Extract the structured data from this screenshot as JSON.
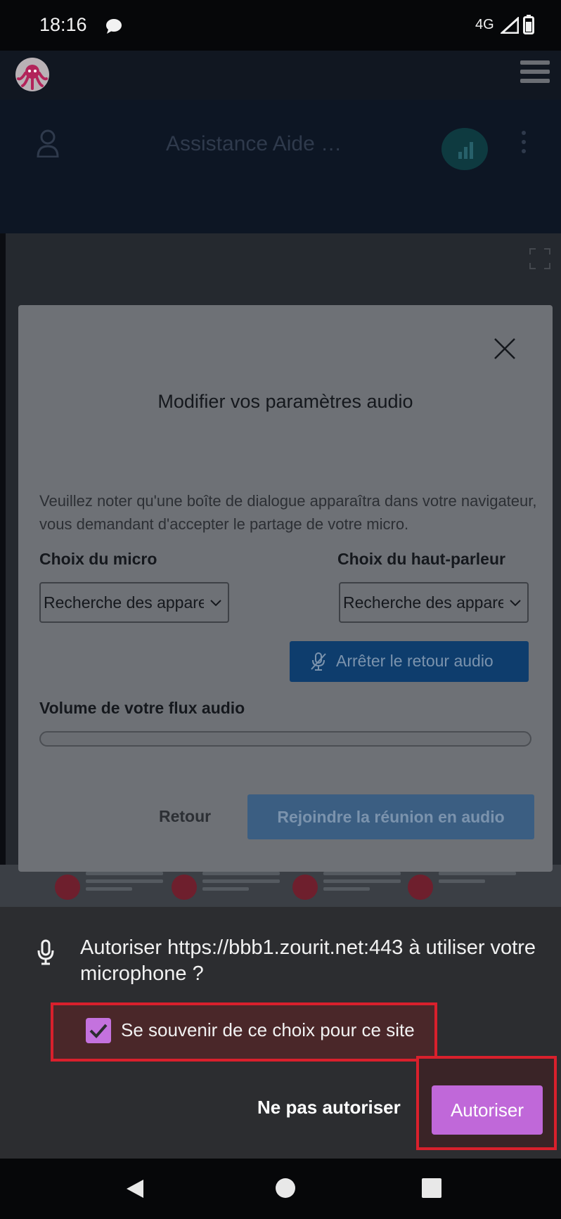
{
  "status_bar": {
    "time": "18:16",
    "network": "4G"
  },
  "meeting": {
    "title": "Assistance Aide …"
  },
  "modal": {
    "title": "Modifier vos paramètres audio",
    "note": "Veuillez noter qu'une boîte de dialogue apparaîtra dans votre navigateur, vous demandant d'accepter le partage de votre micro.",
    "mic_label": "Choix du micro",
    "mic_select": "Recherche des appareils",
    "speaker_label": "Choix du haut-parleur",
    "speaker_select": "Recherche des appareils",
    "stop_audio_button": "Arrêter le retour audio",
    "volume_label": "Volume de votre flux audio",
    "volume_level": 0,
    "back_button": "Retour",
    "join_button": "Rejoindre la réunion en audio"
  },
  "permission": {
    "prompt": "Autoriser https://bbb1.zourit.net:443 à utiliser votre microphone ?",
    "remember_checkbox": "Se souvenir de ce choix pour ce site",
    "remember_checked": true,
    "deny_button": "Ne pas autoriser",
    "allow_button": "Autoriser"
  },
  "colors": {
    "allow_accent": "#c068d9",
    "highlight": "#d9202c",
    "primary_button": "#0e3d6d"
  }
}
